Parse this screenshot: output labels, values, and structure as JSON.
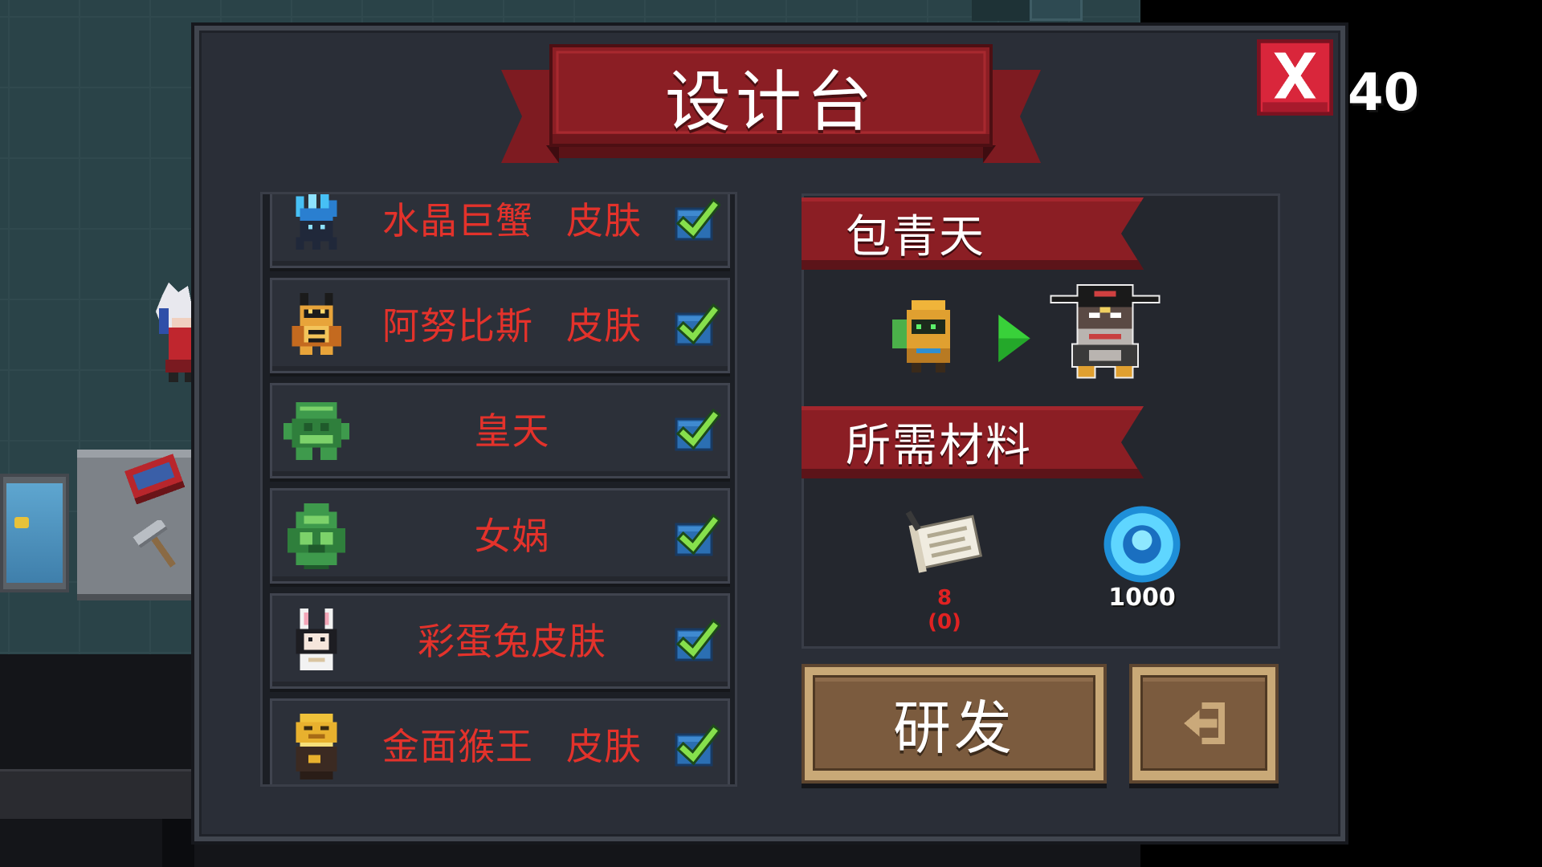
{
  "window": {
    "title": "设计台"
  },
  "hud": {
    "close_icon": "close-x-icon",
    "counter": "40"
  },
  "skin_list": {
    "items": [
      {
        "label": "水晶巨蟹 皮肤",
        "icon": "crystal-crab-icon",
        "checked": true
      },
      {
        "label": "阿努比斯 皮肤",
        "icon": "anubis-icon",
        "checked": true
      },
      {
        "label": "皇天",
        "icon": "huangtian-statue-icon",
        "checked": true
      },
      {
        "label": "女娲",
        "icon": "nuwa-statue-icon",
        "checked": true
      },
      {
        "label": "彩蛋兔皮肤",
        "icon": "easter-bunny-icon",
        "checked": true
      },
      {
        "label": "金面猴王 皮肤",
        "icon": "golden-monkey-king-icon",
        "checked": true
      }
    ]
  },
  "detail": {
    "selected_name": "包青天",
    "from_icon": "knight-icon",
    "arrow_icon": "play-arrow-icon",
    "to_icon": "bao-qingtian-icon",
    "materials_header": "所需材料",
    "materials": [
      {
        "icon": "scroll-icon",
        "required": "8",
        "owned": "(0)"
      },
      {
        "icon": "blue-gem-icon",
        "required": "1000"
      }
    ]
  },
  "actions": {
    "research_label": "研发",
    "exit_icon": "exit-icon"
  },
  "colors": {
    "banner_red": "#8b1e24",
    "item_text": "#e3322b",
    "cost_red": "#e02222",
    "panel_bg": "#2a2e37",
    "check_green": "#86e04c",
    "button_fill": "#7b5b3e",
    "button_trim": "#c9a977"
  }
}
